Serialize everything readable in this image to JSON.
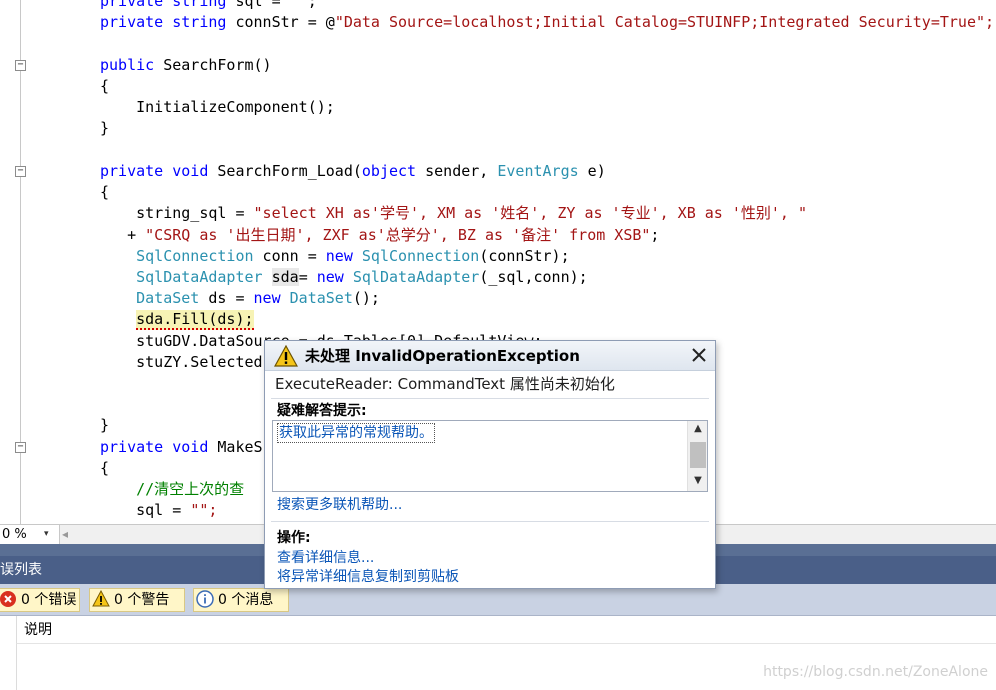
{
  "editor": {
    "lines": {
      "l0": "        private string sql = \"\";",
      "l1_kw": "private string",
      "l1_rest": " connStr = @",
      "l1_str": "\"Data Source=localhost;Initial Catalog=STUINFP;Integrated Security=True\";",
      "l2_kw": "public",
      "l2_rest": " SearchForm()",
      "l3": "{",
      "l4": "    InitializeComponent();",
      "l5": "}",
      "l6_kw1": "private void",
      "l6_mid": " SearchForm_Load(",
      "l6_kw2": "object",
      "l6_mid2": " sender, ",
      "l6_ty": "EventArgs",
      "l6_end": " e)",
      "l7": "{",
      "l8_a": "    string_sql = ",
      "l8_str": "\"select XH as'学号', XM as '姓名', ZY as '专业', XB as '性别', \"",
      "l9_a": "   + ",
      "l9_str": "\"CSRQ as '出生日期', ZXF as'总学分', BZ as '备注' from XSB\"",
      "l9_end": ";",
      "l10_ty": "SqlConnection",
      "l10_mid": " conn = ",
      "l10_kw": "new",
      "l10_ty2": " SqlConnection",
      "l10_end": "(connStr);",
      "l11_ty": "SqlDataAdapter",
      "l11_var": "sda",
      "l11_mid": "= ",
      "l11_kw": "new",
      "l11_ty2": " SqlDataAdapter",
      "l11_end": "(_sql,conn);",
      "l12_ty": "DataSet",
      "l12_mid": " ds = ",
      "l12_kw": "new",
      "l12_ty2": " DataSet",
      "l12_end": "();",
      "l13_hl": "sda.Fill(ds);",
      "l14": "    stuGDV.DataSource = ds.Tables[0].DefaultView;",
      "l15": "    stuZY.Selected",
      "l16": "}",
      "l17_kw": "private void",
      "l17_rest": " MakeS",
      "l18": "{",
      "l19_cm": "    //清空上次的查",
      "l20": "    sql = ",
      "l20_str": "\"\";"
    }
  },
  "zoom": {
    "value": "0 %",
    "dropdown": "▾",
    "scroll_left": "◂"
  },
  "panel": {
    "title": "误列表",
    "filters": {
      "errors": "0 个错误",
      "warnings": "0 个警告",
      "messages": "0 个消息"
    },
    "column_description": "说明",
    "watermark": "https://blog.csdn.net/ZoneAlone"
  },
  "popup": {
    "title": "未处理 InvalidOperationException",
    "message": "ExecuteReader: CommandText 属性尚未初始化",
    "tips_label": "疑难解答提示:",
    "tip_link": "获取此异常的常规帮助。",
    "more_help": "搜索更多联机帮助...",
    "actions_label": "操作:",
    "action_details": "查看详细信息...",
    "action_copy": "将异常详细信息复制到剪贴板"
  }
}
